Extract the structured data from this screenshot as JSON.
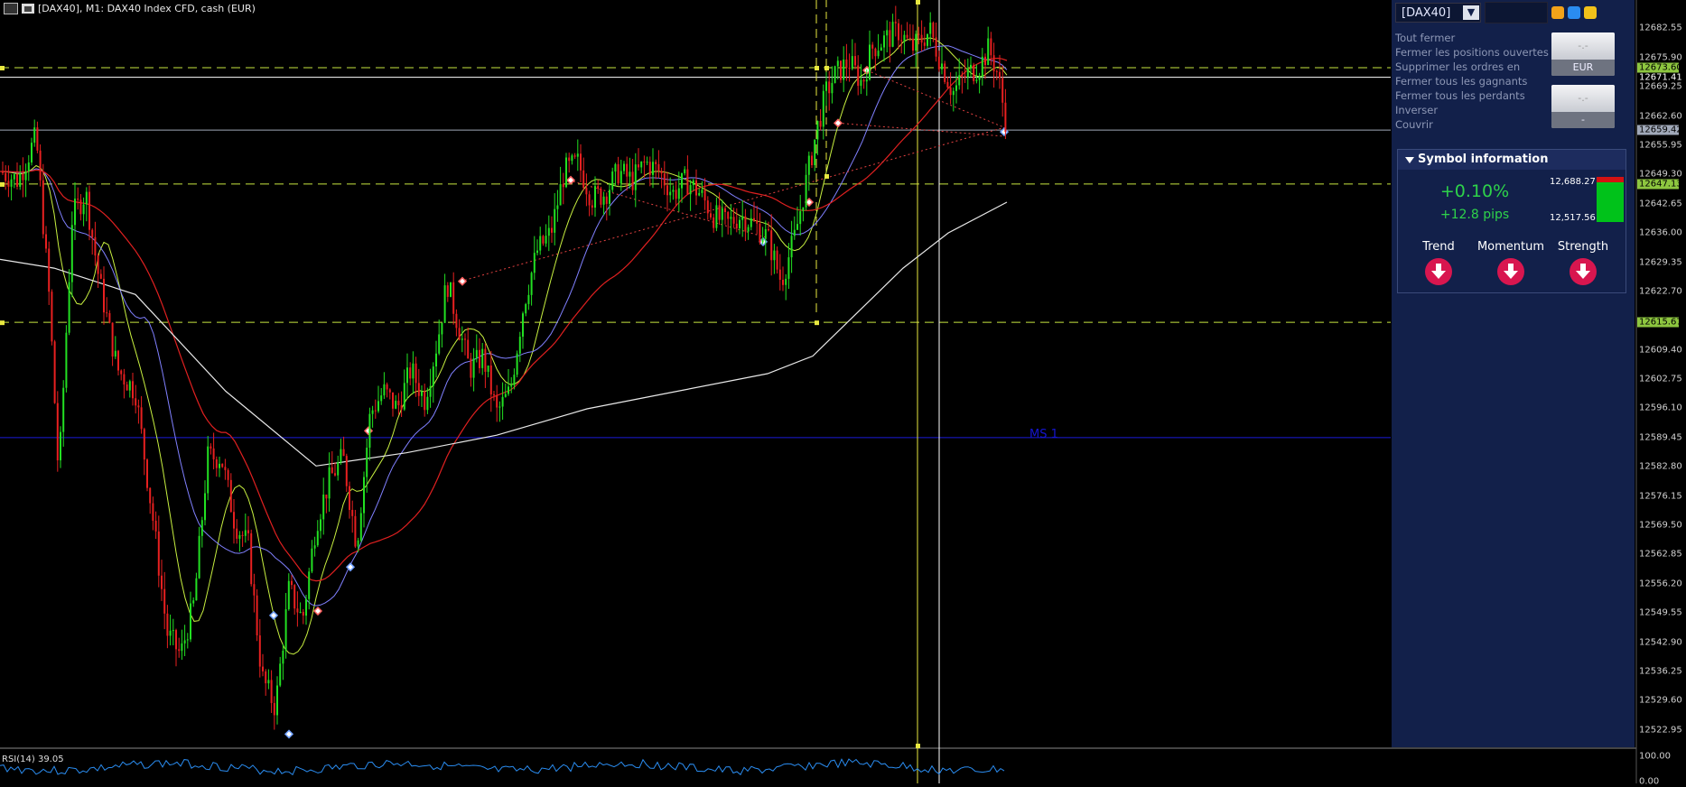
{
  "window": {
    "title": "[DAX40], M1:  DAX40 Index CFD, cash (EUR)"
  },
  "rsi": {
    "label": "RSI(14) 39.05"
  },
  "chart_overlay": {
    "ms_label": "MS 1"
  },
  "price_scale": {
    "ticks": [
      "12682.55",
      "12675.90",
      "12669.25",
      "12662.60",
      "12655.95",
      "12649.30",
      "12642.65",
      "12636.00",
      "12629.35",
      "12622.70",
      "12609.40",
      "12602.75",
      "12596.10",
      "12589.45",
      "12582.80",
      "12576.15",
      "12569.50",
      "12562.85",
      "12556.20",
      "12549.55",
      "12542.90",
      "12536.25",
      "12529.60",
      "12522.95"
    ],
    "tags": [
      {
        "text": "12671.41",
        "bg": "#000000",
        "color": "#ffffff",
        "price": 12671.41
      },
      {
        "text": "12673.60",
        "bg": "#8dc63f",
        "color": "#000000",
        "price": 12673.6
      },
      {
        "text": "12659.42",
        "bg": "#a0a8b8",
        "color": "#000000",
        "price": 12659.42
      },
      {
        "text": "12647.13",
        "bg": "#8dc63f",
        "color": "#000000",
        "price": 12647.13
      },
      {
        "text": "12615.67",
        "bg": "#8dc63f",
        "color": "#000000",
        "price": 12615.67
      }
    ],
    "rsi_ticks": [
      "100.00",
      "0.00"
    ]
  },
  "panel": {
    "symbol": "[DAX40]",
    "menu_items": [
      "Tout fermer",
      "Fermer les positions ouvertes",
      "Supprimer les ordres en",
      "Fermer tous les gagnants",
      "Fermer tous les perdants",
      "Inverser",
      "Couvrir"
    ],
    "buttons": [
      {
        "top": "-.-",
        "bottom": "EUR"
      },
      {
        "top": "-.-",
        "bottom": "-"
      }
    ],
    "icons": [
      {
        "name": "copy-icon",
        "color": "#f2a21a"
      },
      {
        "name": "settings-icon",
        "color": "#2a8cf0"
      },
      {
        "name": "grid-icon",
        "color": "#f2c21a"
      }
    ],
    "symbol_info": {
      "header": "Symbol information",
      "change_pct": "+0.10%",
      "change_pips": "+12.8 pips",
      "high": "12,688.27",
      "low": "12,517.56",
      "bar_red_fraction": 0.12,
      "indicators": [
        {
          "label": "Trend",
          "direction": "down"
        },
        {
          "label": "Momentum",
          "direction": "down"
        },
        {
          "label": "Strength",
          "direction": "down"
        }
      ]
    }
  },
  "chart_data": {
    "type": "candlestick",
    "timeframe": "M1",
    "price_range": [
      12519,
      12689
    ],
    "colors": {
      "up": "#22e022",
      "down": "#e82020"
    },
    "horizontal_levels": [
      12673.6,
      12671.41,
      12659.42,
      12647.13,
      12615.67,
      12589.45
    ],
    "rsi_value": 39.05
  }
}
